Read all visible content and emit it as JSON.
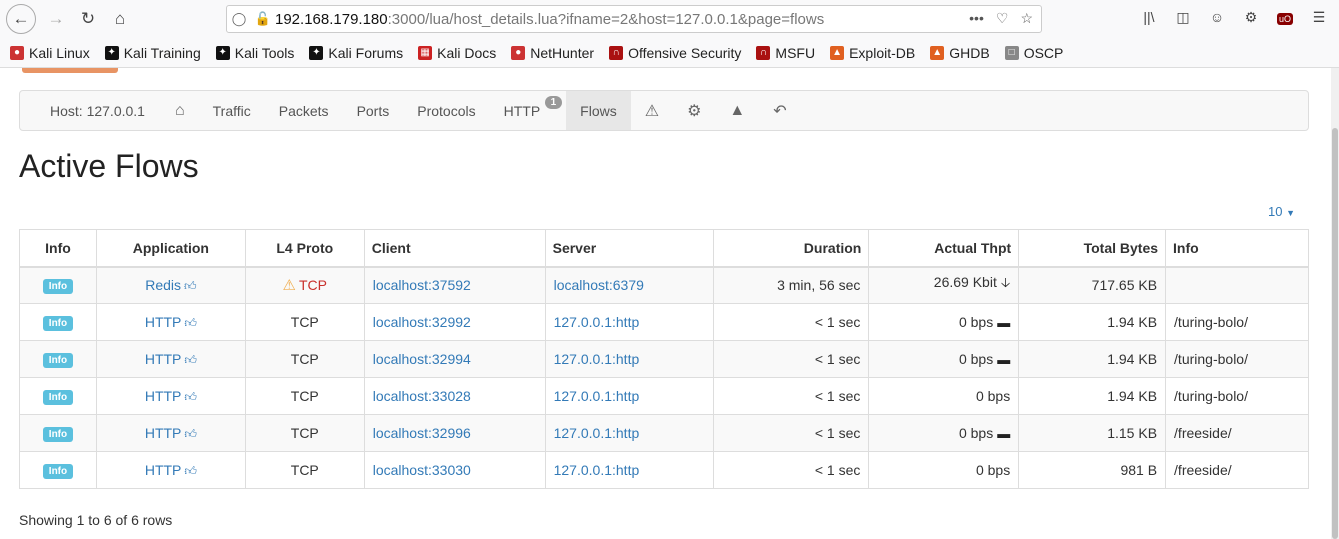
{
  "browser": {
    "url_host": "192.168.179.180",
    "url_rest": ":3000/lua/host_details.lua?ifname=2&host=127.0.0.1&page=flows",
    "url_dots": "•••",
    "bookmarks": [
      {
        "label": "Kali Linux",
        "icon": "kali-icon",
        "color": "#cc3333"
      },
      {
        "label": "Kali Training",
        "icon": "kali-dragon-icon",
        "color": "#111111"
      },
      {
        "label": "Kali Tools",
        "icon": "kali-dragon-icon",
        "color": "#111111"
      },
      {
        "label": "Kali Forums",
        "icon": "kali-dragon-icon",
        "color": "#111111"
      },
      {
        "label": "Kali Docs",
        "icon": "kali-docs-icon",
        "color": "#cc2222"
      },
      {
        "label": "NetHunter",
        "icon": "nethunter-icon",
        "color": "#cc3333"
      },
      {
        "label": "Offensive Security",
        "icon": "offsec-icon",
        "color": "#aa1111"
      },
      {
        "label": "MSFU",
        "icon": "offsec-icon",
        "color": "#aa1111"
      },
      {
        "label": "Exploit-DB",
        "icon": "exploitdb-icon",
        "color": "#e06020"
      },
      {
        "label": "GHDB",
        "icon": "exploitdb-icon",
        "color": "#e06020"
      },
      {
        "label": "OSCP",
        "icon": "folder-icon",
        "color": "#888888"
      }
    ]
  },
  "nav": {
    "host_label": "Host: 127.0.0.1",
    "items": [
      "Traffic",
      "Packets",
      "Ports",
      "Protocols",
      "HTTP",
      "Flows"
    ],
    "http_badge": "1"
  },
  "page": {
    "title": "Active Flows",
    "page_size": "10",
    "footer": "Showing 1 to 6 of 6 rows"
  },
  "table": {
    "headers": [
      "Info",
      "Application",
      "L4 Proto",
      "Client",
      "Server",
      "Duration",
      "Actual Thpt",
      "Total Bytes",
      "Info"
    ],
    "rows": [
      {
        "info": "Info",
        "app": "Redis",
        "proto": "TCP",
        "proto_warn": true,
        "client_host": "localhost",
        "client_port": ":37592",
        "server_host": "localhost",
        "server_port": ":6379",
        "duration": "3 min, 56 sec",
        "thpt": "26.69 Kbit",
        "trend": "down",
        "bytes": "717.65 KB",
        "extra": ""
      },
      {
        "info": "Info",
        "app": "HTTP",
        "proto": "TCP",
        "proto_warn": false,
        "client_host": "localhost",
        "client_port": ":32992",
        "server_host": "127.0.0.1",
        "server_port": ":http",
        "duration": "< 1 sec",
        "thpt": "0 bps",
        "trend": "flat",
        "bytes": "1.94 KB",
        "extra": "/turing-bolo/"
      },
      {
        "info": "Info",
        "app": "HTTP",
        "proto": "TCP",
        "proto_warn": false,
        "client_host": "localhost",
        "client_port": ":32994",
        "server_host": "127.0.0.1",
        "server_port": ":http",
        "duration": "< 1 sec",
        "thpt": "0 bps",
        "trend": "flat",
        "bytes": "1.94 KB",
        "extra": "/turing-bolo/"
      },
      {
        "info": "Info",
        "app": "HTTP",
        "proto": "TCP",
        "proto_warn": false,
        "client_host": "localhost",
        "client_port": ":33028",
        "server_host": "127.0.0.1",
        "server_port": ":http",
        "duration": "< 1 sec",
        "thpt": "0 bps",
        "trend": "none",
        "bytes": "1.94 KB",
        "extra": "/turing-bolo/"
      },
      {
        "info": "Info",
        "app": "HTTP",
        "proto": "TCP",
        "proto_warn": false,
        "client_host": "localhost",
        "client_port": ":32996",
        "server_host": "127.0.0.1",
        "server_port": ":http",
        "duration": "< 1 sec",
        "thpt": "0 bps",
        "trend": "flat",
        "bytes": "1.15 KB",
        "extra": "/freeside/"
      },
      {
        "info": "Info",
        "app": "HTTP",
        "proto": "TCP",
        "proto_warn": false,
        "client_host": "localhost",
        "client_port": ":33030",
        "server_host": "127.0.0.1",
        "server_port": ":http",
        "duration": "< 1 sec",
        "thpt": "0 bps",
        "trend": "none",
        "bytes": "981 B",
        "extra": "/freeside/"
      }
    ]
  }
}
